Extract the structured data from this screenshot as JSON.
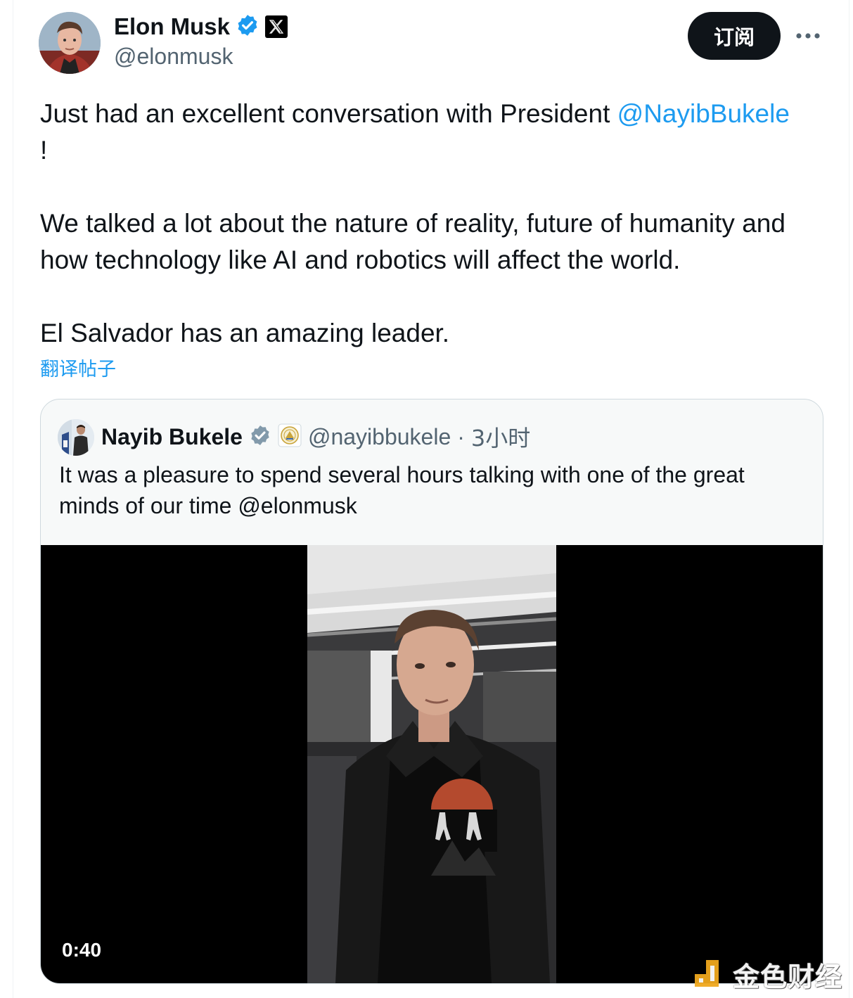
{
  "author": {
    "name": "Elon Musk",
    "handle": "@elonmusk",
    "verified_icon": "verified-badge-icon",
    "affiliate_icon": "x-logo-icon"
  },
  "actions": {
    "subscribe_label": "订阅",
    "more_icon": "more-horizontal-icon"
  },
  "tweet": {
    "text_before_mention": "Just had an excellent conversation with President ",
    "mention": "@NayibBukele",
    "text_after_mention": "!",
    "paragraph_2": "We talked a lot about the nature of reality, future of humanity and how technology like AI and robotics will affect the world.",
    "paragraph_3": "El Salvador has an amazing leader.",
    "translate_label": "翻译帖子"
  },
  "quote": {
    "name": "Nayib Bukele",
    "handle": "@nayibbukele",
    "separator": "·",
    "time": "3小时",
    "text": "It was a pleasure to spend several hours talking with one of the great minds of our time @elonmusk",
    "video_duration": "0:40"
  },
  "watermark": {
    "text": "金色财经"
  },
  "colors": {
    "accent": "#1d9bf0",
    "text_primary": "#0f1419",
    "text_secondary": "#536471",
    "verified": "#1d9bf0",
    "quote_verified": "#829aab",
    "button_bg": "#0f1419",
    "watermark_yellow": "#f0a81e"
  }
}
